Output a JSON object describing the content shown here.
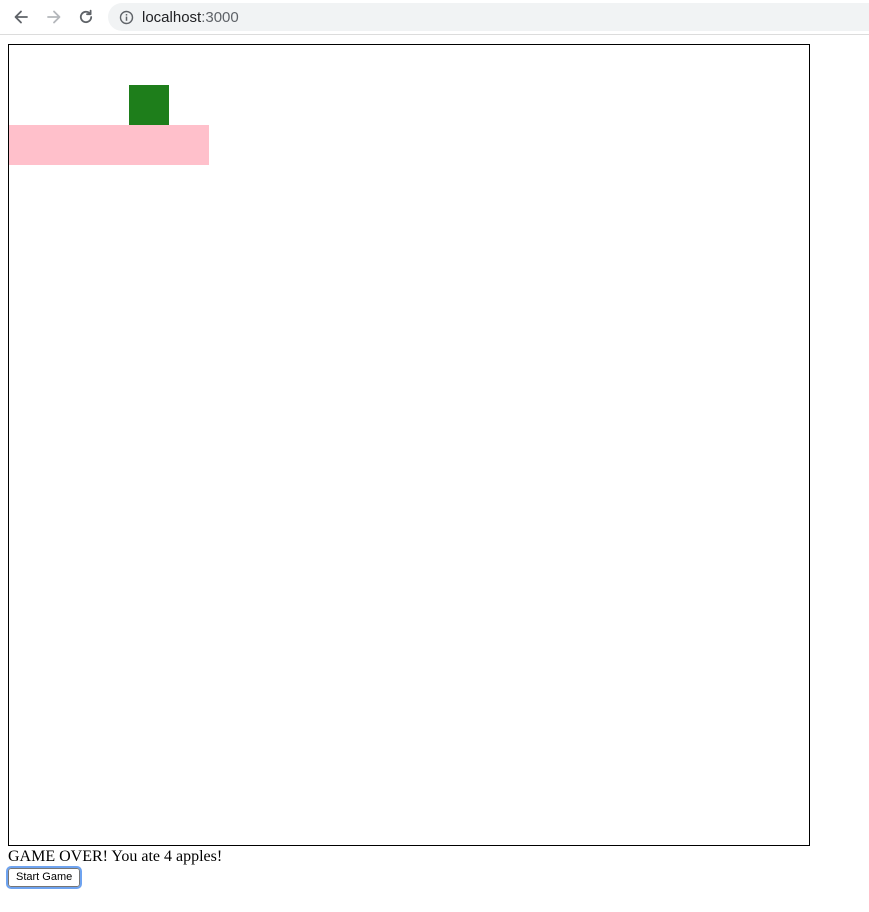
{
  "browser": {
    "back_icon": "arrow-left-icon",
    "forward_icon": "arrow-right-icon",
    "reload_icon": "reload-icon",
    "info_icon": "info-icon",
    "url_host": "localhost",
    "url_port": ":3000"
  },
  "game": {
    "grid_cell_units": 40,
    "board_units": 800,
    "snake": [
      {
        "col": 0,
        "row": 2
      },
      {
        "col": 1,
        "row": 2
      },
      {
        "col": 2,
        "row": 2
      },
      {
        "col": 3,
        "row": 2
      },
      {
        "col": 4,
        "row": 2
      }
    ],
    "apple": {
      "col": 3,
      "row": 1
    },
    "snake_color": "#ffc0cb",
    "apple_color": "#1e7e1b"
  },
  "status": {
    "message": "GAME OVER! You ate 4 apples!"
  },
  "controls": {
    "start_label": "Start Game"
  }
}
